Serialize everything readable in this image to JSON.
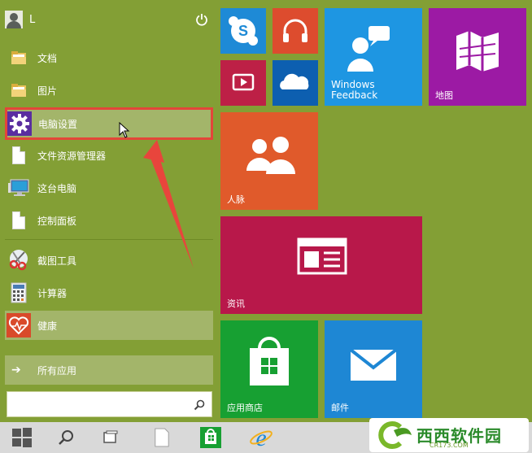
{
  "user": {
    "name": "L"
  },
  "menu": {
    "items": [
      {
        "label": "文档",
        "icon": "folder-icon"
      },
      {
        "label": "图片",
        "icon": "folder-icon"
      },
      {
        "label": "电脑设置",
        "icon": "gear-icon"
      },
      {
        "label": "文件资源管理器",
        "icon": "document-icon"
      },
      {
        "label": "这台电脑",
        "icon": "computer-icon"
      },
      {
        "label": "控制面板",
        "icon": "document-icon"
      },
      {
        "label": "截图工具",
        "icon": "scissors-icon"
      },
      {
        "label": "计算器",
        "icon": "calculator-icon"
      },
      {
        "label": "健康",
        "icon": "heart-icon"
      }
    ],
    "all_apps": "所有应用",
    "search_placeholder": ""
  },
  "tiles": {
    "skype": {
      "label": "",
      "color": "#1e8ad6"
    },
    "music": {
      "label": "",
      "color": "#dd4c2e"
    },
    "video": {
      "label": "",
      "color": "#bd2046"
    },
    "onedrive": {
      "label": "",
      "color": "#0d5fb0"
    },
    "feedback": {
      "label": "Windows\nFeedback",
      "line1": "Windows",
      "line2": "Feedback",
      "color": "#1e96e2"
    },
    "maps": {
      "label": "地图",
      "color": "#9c1aa4"
    },
    "people": {
      "label": "人脉",
      "color": "#e05a2b"
    },
    "news": {
      "label": "资讯",
      "color": "#b8184a"
    },
    "store": {
      "label": "应用商店",
      "color": "#17a032"
    },
    "mail": {
      "label": "邮件",
      "color": "#1e87d4"
    }
  },
  "watermark": {
    "text": "西西软件园",
    "sub": "CR173.COM"
  },
  "colors": {
    "background": "#839f35",
    "highlight": "#a3b56a",
    "selection": "#e3463a",
    "taskbar": "#d9d9d9"
  }
}
